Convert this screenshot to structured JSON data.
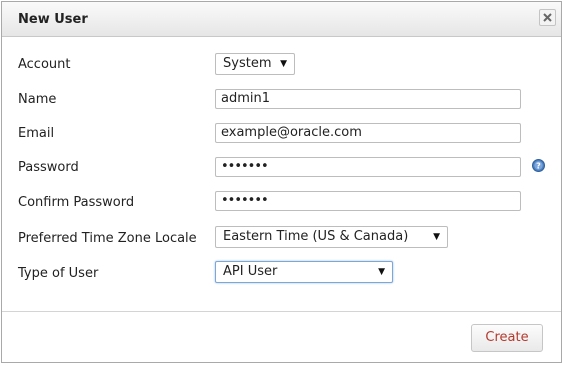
{
  "dialog": {
    "title": "New User",
    "close_icon": "close-icon"
  },
  "form": {
    "account": {
      "label": "Account",
      "value": "System"
    },
    "name": {
      "label": "Name",
      "value": "admin1"
    },
    "email": {
      "label": "Email",
      "value": "example@oracle.com"
    },
    "password": {
      "label": "Password",
      "value": "•••••••",
      "help_icon": "help-icon"
    },
    "confirm_password": {
      "label": "Confirm Password",
      "value": "•••••••"
    },
    "time_zone": {
      "label": "Preferred Time Zone Locale",
      "value": "Eastern Time (US & Canada)"
    },
    "user_type": {
      "label": "Type of User",
      "value": "API User"
    }
  },
  "actions": {
    "create_label": "Create"
  },
  "colors": {
    "create_text": "#b53a2e",
    "help_icon": "#4a7fbf"
  }
}
